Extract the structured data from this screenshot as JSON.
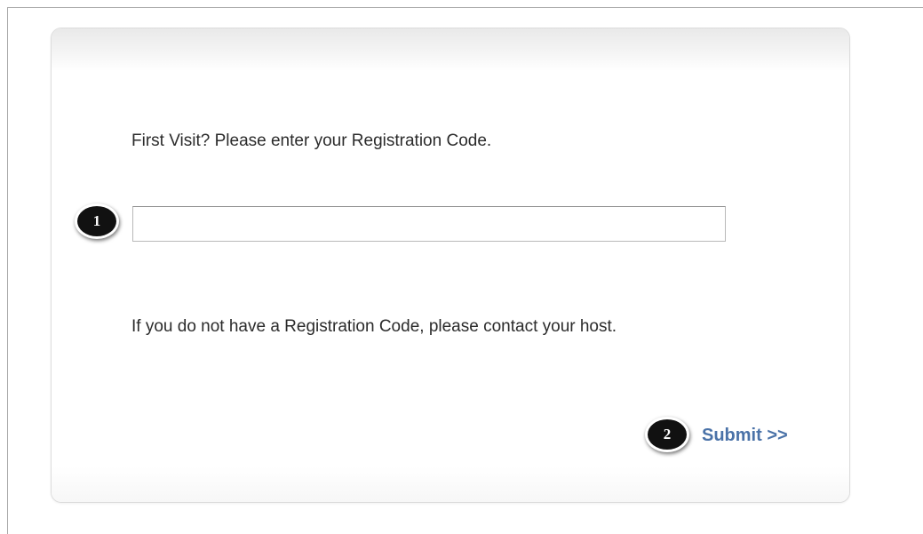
{
  "registration": {
    "prompt": "First Visit? Please enter your Registration Code.",
    "code_value": "",
    "code_placeholder": "",
    "help_text": "If you do not have a Registration Code, please contact your host.",
    "submit_label": "Submit >>"
  },
  "annotations": {
    "marker_1": "1",
    "marker_2": "2"
  },
  "colors": {
    "link": "#4a72a8",
    "text": "#2b2b2b",
    "marker_fill": "#111111",
    "panel_border": "#dcdcdc"
  }
}
